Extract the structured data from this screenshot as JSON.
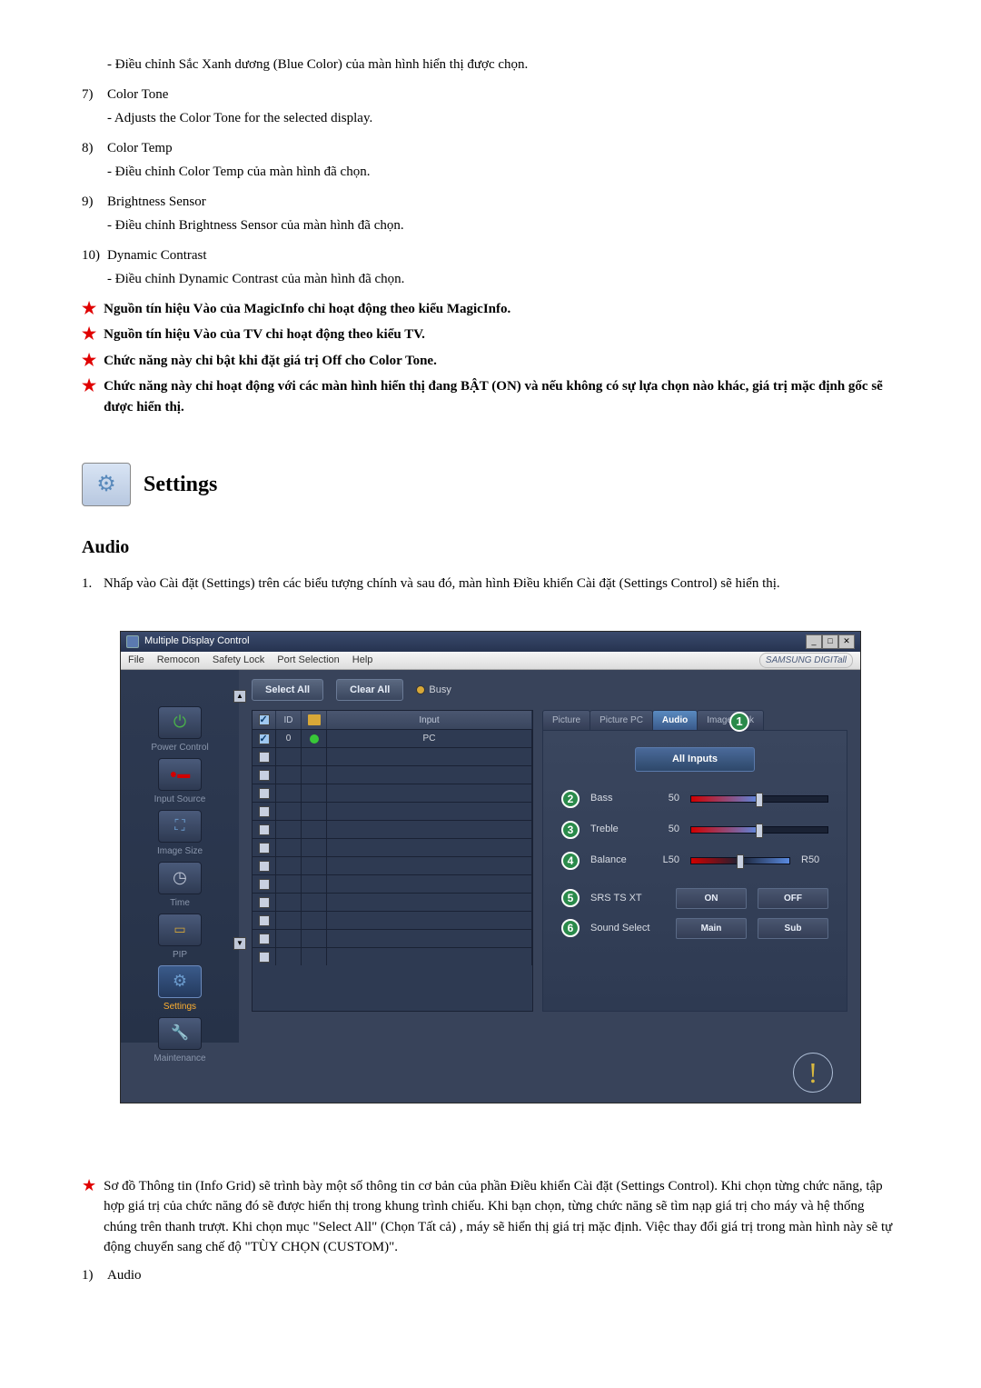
{
  "top_list": {
    "sub_blue": "- Điều chỉnh Sắc Xanh dương (Blue Color) của màn hình hiển thị được chọn.",
    "n7": "7)",
    "t7": "Color Tone",
    "d7": "- Adjusts the Color Tone for the selected display.",
    "n8": "8)",
    "t8": "Color Temp",
    "d8": "- Điều chỉnh Color Temp của màn hình đã chọn.",
    "n9": "9)",
    "t9": "Brightness Sensor",
    "d9": "- Điều chỉnh Brightness Sensor của màn hình đã chọn.",
    "n10": "10)",
    "t10": "Dynamic Contrast",
    "d10": "- Điều chỉnh Dynamic Contrast của màn hình đã chọn."
  },
  "notes": {
    "s1": "Nguồn tín hiệu Vào của MagicInfo chỉ hoạt động theo kiểu MagicInfo.",
    "s2": "Nguồn tín hiệu Vào của TV chỉ hoạt động theo kiểu TV.",
    "s3": "Chức năng này chỉ bật khi đặt giá trị Off cho Color Tone.",
    "s4": "Chức năng này chỉ hoạt động với các màn hình hiển thị đang BẬT (ON) và nếu không có sự lựa chọn nào khác, giá trị mặc định gốc sẽ được hiển thị."
  },
  "settings_title": "Settings",
  "audio_title": "Audio",
  "audio_step1_n": "1.",
  "audio_step1_t": "Nhấp vào Cài đặt (Settings) trên các biểu tượng chính và sau đó, màn hình Điều khiển Cài đặt (Settings Control) sẽ hiển thị.",
  "app": {
    "title": "Multiple Display Control",
    "menu": {
      "file": "File",
      "remocon": "Remocon",
      "safety": "Safety Lock",
      "port": "Port Selection",
      "help": "Help"
    },
    "samsung": "SAMSUNG DIGITall",
    "select_all": "Select All",
    "clear_all": "Clear All",
    "busy": "Busy",
    "side": {
      "power": "Power Control",
      "input": "Input Source",
      "image": "Image Size",
      "time": "Time",
      "pip": "PIP",
      "settings": "Settings",
      "maint": "Maintenance"
    },
    "grid": {
      "h2": "ID",
      "h4": "Input",
      "r1_id": "0",
      "r1_input": "PC"
    },
    "tabs": {
      "picture": "Picture",
      "picture_pc": "Picture PC",
      "audio": "Audio",
      "image_lock": "Image Lock"
    },
    "all_inputs": "All Inputs",
    "sliders": {
      "bass": {
        "label": "Bass",
        "val": "50"
      },
      "treble": {
        "label": "Treble",
        "val": "50"
      },
      "balance": {
        "label": "Balance",
        "val_l": "L50",
        "val_r": "R50"
      }
    },
    "opts": {
      "srs": {
        "label": "SRS TS XT",
        "on": "ON",
        "off": "OFF"
      },
      "sound": {
        "label": "Sound Select",
        "main": "Main",
        "sub": "Sub"
      }
    },
    "callouts": {
      "c1": "1",
      "c2": "2",
      "c3": "3",
      "c4": "4",
      "c5": "5",
      "c6": "6"
    }
  },
  "bottom": {
    "info_note": "Sơ đồ Thông tin (Info Grid) sẽ trình bày một số thông tin cơ bản của phần Điều khiển Cài đặt (Settings Control). Khi chọn từng chức năng, tập hợp giá trị của chức năng đó sẽ được hiển thị trong khung trình chiếu. Khi bạn chọn, từng chức năng sẽ tìm nạp giá trị cho máy và hệ thống chúng trên thanh trượt. Khi chọn mục \"Select All\" (Chọn Tất cả) , máy sẽ hiển thị giá trị mặc định. Việc thay đổi giá trị trong màn hình này sẽ tự động chuyển sang chế độ \"TÙY CHỌN (CUSTOM)\".",
    "n1": "1)",
    "t1": "Audio"
  }
}
